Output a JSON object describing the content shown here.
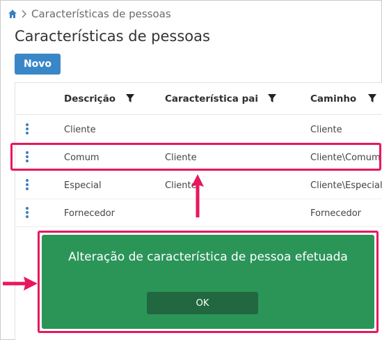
{
  "breadcrumb": {
    "icon": "home-icon",
    "separator_icon": "chevron-right-icon",
    "current": "Características de pessoas"
  },
  "page": {
    "title": "Características de pessoas"
  },
  "toolbar": {
    "new_label": "Novo"
  },
  "grid": {
    "columns": [
      {
        "label": "Descrição",
        "filter_icon": "filter-icon"
      },
      {
        "label": "Característica pai",
        "filter_icon": "filter-icon"
      },
      {
        "label": "Caminho",
        "filter_icon": "filter-icon"
      }
    ],
    "rows": [
      {
        "descricao": "Cliente",
        "pai": "",
        "caminho": "Cliente"
      },
      {
        "descricao": "Comum",
        "pai": "Cliente",
        "caminho": "Cliente\\Comum"
      },
      {
        "descricao": "Especial",
        "pai": "Cliente",
        "caminho": "Cliente\\Especial"
      },
      {
        "descricao": "Fornecedor",
        "pai": "",
        "caminho": "Fornecedor"
      }
    ]
  },
  "toast": {
    "message": "Alteração de característica de pessoa efetuada",
    "ok_label": "OK"
  },
  "colors": {
    "accent_blue": "#3a87c8",
    "toast_green": "#2b9558",
    "toast_button": "#21673f",
    "highlight_pink": "#e8175d"
  }
}
